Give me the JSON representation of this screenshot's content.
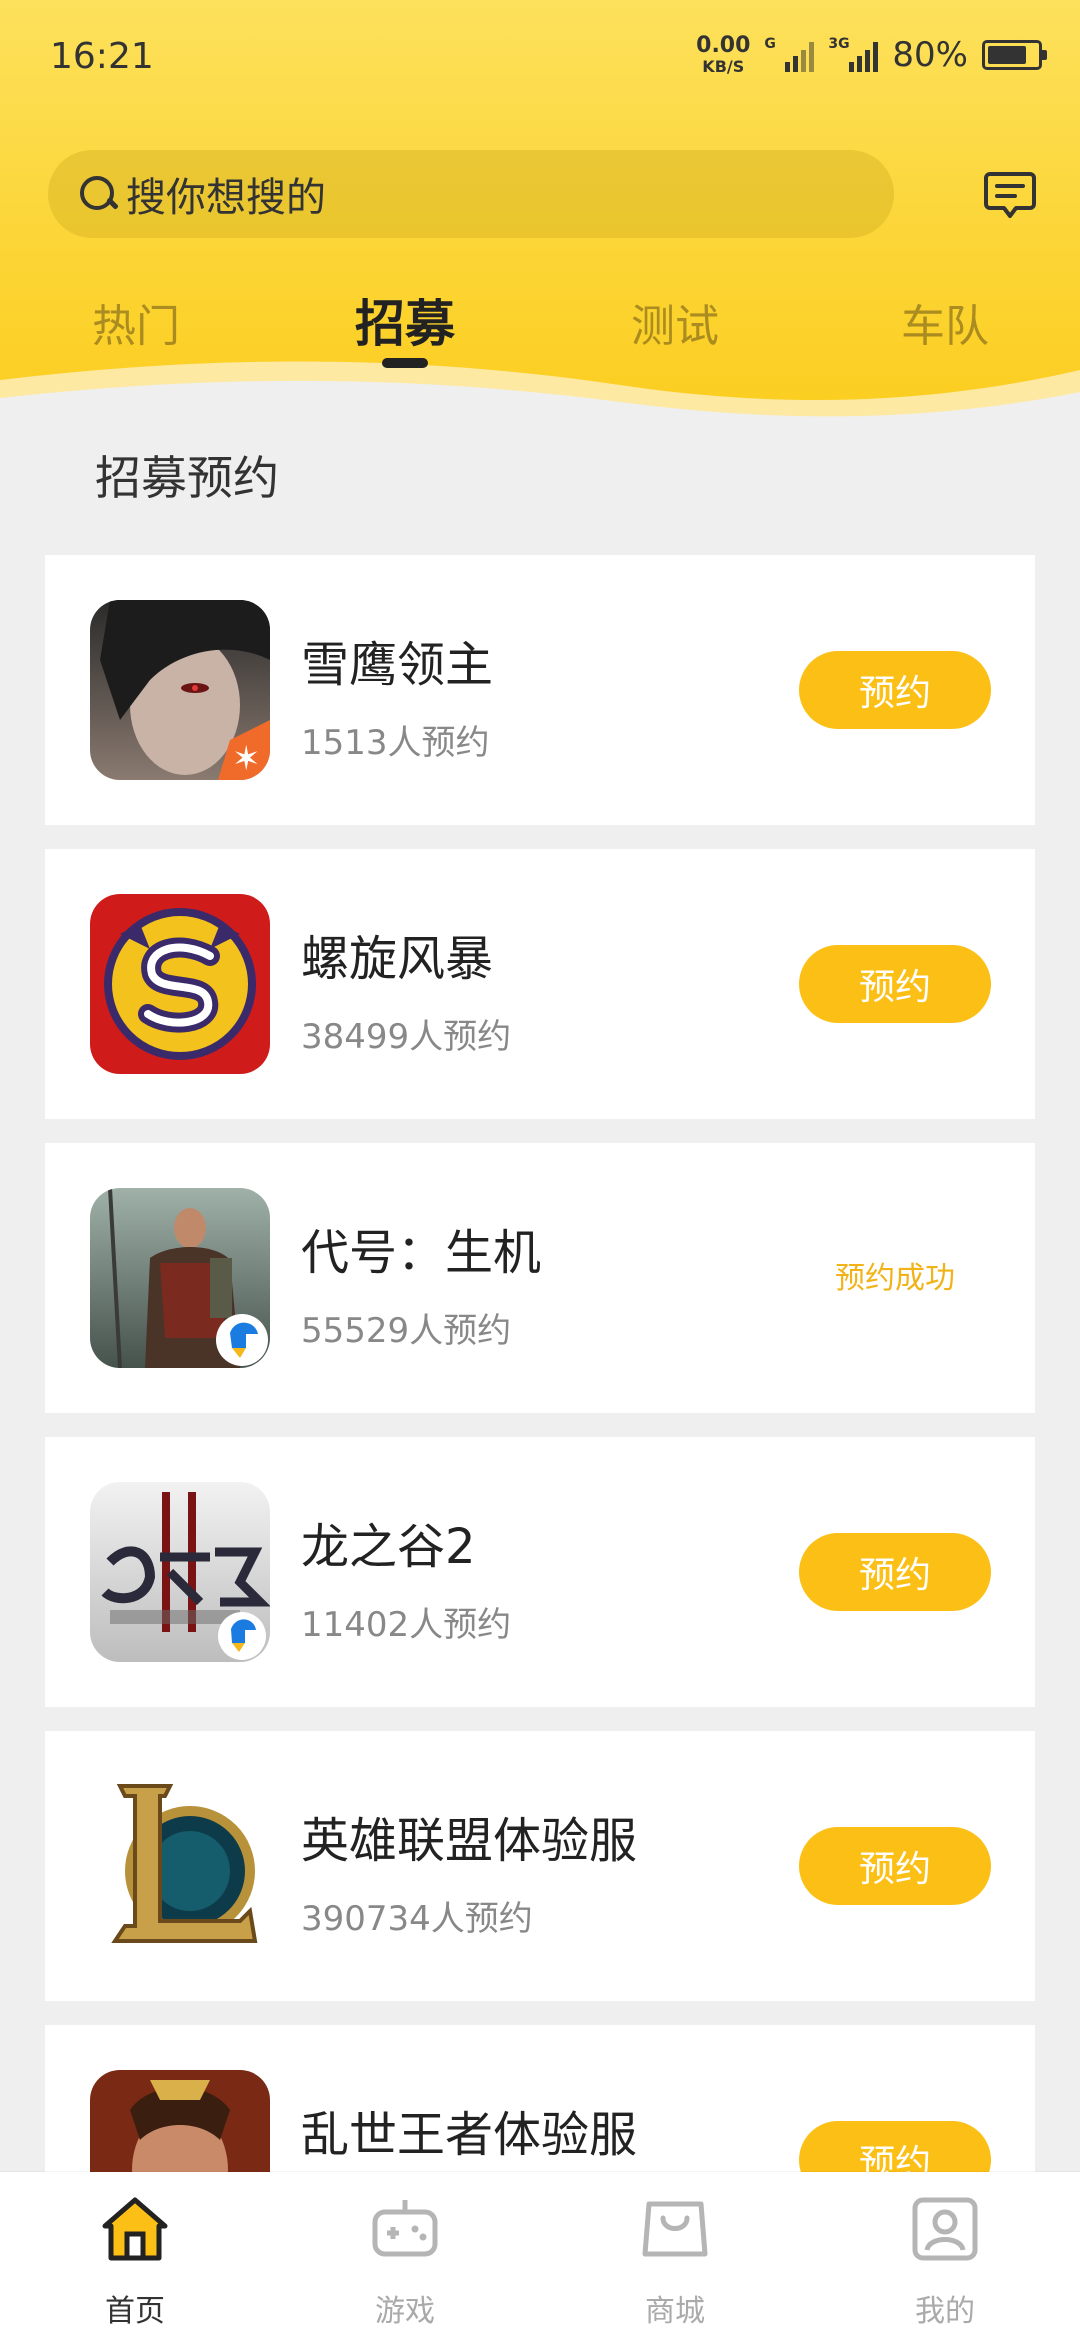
{
  "status_bar": {
    "time": "16:21",
    "net_speed_value": "0.00",
    "net_speed_unit": "KB/S",
    "signal1_label": "G",
    "signal2_label": "3G",
    "battery": "80%"
  },
  "search": {
    "placeholder": "搜你想搜的"
  },
  "tabs": [
    {
      "label": "热门",
      "active": false
    },
    {
      "label": "招募",
      "active": true
    },
    {
      "label": "测试",
      "active": false
    },
    {
      "label": "车队",
      "active": false
    }
  ],
  "section_title": "招募预约",
  "games": [
    {
      "title": "雪鹰领主",
      "count": "1513人预约",
      "action": "预约",
      "reserved": false
    },
    {
      "title": "螺旋风暴",
      "count": "38499人预约",
      "action": "预约",
      "reserved": false
    },
    {
      "title": "代号：生机",
      "count": "55529人预约",
      "action": "预约成功",
      "reserved": true
    },
    {
      "title": "龙之谷2",
      "count": "11402人预约",
      "action": "预约",
      "reserved": false
    },
    {
      "title": "英雄联盟体验服",
      "count": "390734人预约",
      "action": "预约",
      "reserved": false
    },
    {
      "title": "乱世王者体验服",
      "count": "",
      "action": "预约",
      "reserved": false
    }
  ],
  "bottom_nav": [
    {
      "label": "首页",
      "icon": "home-icon",
      "active": true
    },
    {
      "label": "游戏",
      "icon": "gamepad-icon",
      "active": false
    },
    {
      "label": "商城",
      "icon": "shopping-bag-icon",
      "active": false
    },
    {
      "label": "我的",
      "icon": "profile-icon",
      "active": false
    }
  ],
  "colors": {
    "brand_yellow": "#fcd535",
    "button_yellow": "#fbbf16",
    "reserved_text": "#f2b318"
  }
}
